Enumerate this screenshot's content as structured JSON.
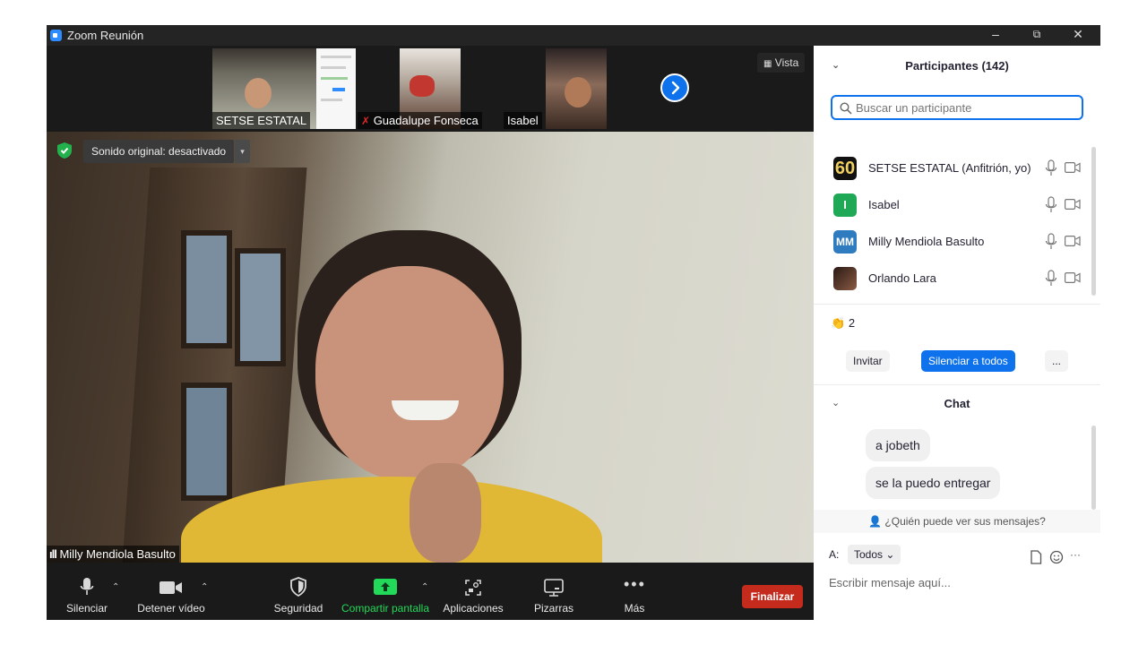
{
  "window": {
    "title": "Zoom Reunión",
    "minimize": "–",
    "restore": "⧉",
    "close": "✕"
  },
  "thumbnails": [
    {
      "name": "SETSE ESTATAL",
      "muted": false
    },
    {
      "name": "Guadalupe Fonseca",
      "muted": true
    },
    {
      "name": "Isabel",
      "muted": false
    }
  ],
  "view_button": {
    "icon": "grid-icon",
    "label": "Vista"
  },
  "video": {
    "audio_badge": "Sonido original: desactivado",
    "audio_dropdown": "▾",
    "speaker_name": "Milly Mendiola Basulto",
    "speaker_signal": "ıll"
  },
  "toolbar": {
    "mute_label": "Silenciar",
    "video_label": "Detener vídeo",
    "security_label": "Seguridad",
    "share_label": "Compartir pantalla",
    "apps_label": "Aplicaciones",
    "whiteboards_label": "Pizarras",
    "more_label": "Más",
    "end_label": "Finalizar",
    "caret": "⌃",
    "share_color": "#23d959",
    "end_color": "#c42b1c"
  },
  "participants": {
    "title": "Participantes (142)",
    "collapse": "⌄",
    "search_placeholder": "Buscar un participante",
    "list": [
      {
        "avatar": "60",
        "name": "SETSE ESTATAL (Anfitrión, yo)",
        "avatar_color": "#111111"
      },
      {
        "avatar": "I",
        "name": "Isabel",
        "avatar_color": "#1fa855"
      },
      {
        "avatar": "MM",
        "name": "Milly Mendiola Basulto",
        "avatar_color": "#2f7bbf"
      },
      {
        "avatar": "",
        "name": "Orlando Lara",
        "avatar_color": "#5a3a2a"
      }
    ],
    "reaction_emoji": "👏",
    "reaction_count": "2",
    "invite_label": "Invitar",
    "mute_all_label": "Silenciar a todos",
    "more_label": "..."
  },
  "chat": {
    "title": "Chat",
    "collapse": "⌄",
    "messages": [
      "a jobeth",
      "se la puedo entregar"
    ],
    "who_can_see": "¿Quién puede ver sus mensajes?",
    "to_label": "A:",
    "recipient": "Todos",
    "recipient_caret": "⌄",
    "more": "···",
    "input_placeholder": "Escribir mensaje aquí..."
  }
}
